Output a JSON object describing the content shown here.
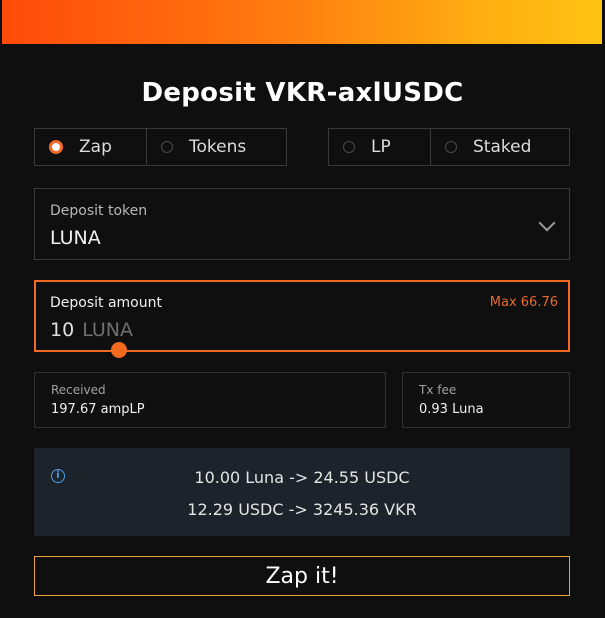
{
  "title": "Deposit VKR-axlUSDC",
  "mode_tabs": [
    {
      "label": "Zap",
      "selected": true
    },
    {
      "label": "Tokens",
      "selected": false
    },
    {
      "label": "LP",
      "selected": false
    },
    {
      "label": "Staked",
      "selected": false
    }
  ],
  "deposit_token": {
    "label": "Deposit token",
    "value": "LUNA"
  },
  "deposit_amount": {
    "label": "Deposit amount",
    "max": "Max 66.76",
    "value": "10",
    "unit": "LUNA"
  },
  "received": {
    "label": "Received",
    "value": "197.67 ampLP"
  },
  "tx_fee": {
    "label": "Tx fee",
    "value": "0.93 Luna"
  },
  "route": {
    "line1": "10.00 Luna -> 24.55 USDC",
    "line2": "12.29 USDC -> 3245.36 VKR"
  },
  "submit_label": "Zap it!",
  "colors": {
    "accent": "#f26a24",
    "header_gradient_start": "#ff4a0a",
    "header_gradient_end": "#ffc313",
    "info_blue": "#4c9be8"
  },
  "icons": {
    "dropdown": "chevron-down-icon",
    "info": "info-icon",
    "slider": "slider-handle"
  }
}
